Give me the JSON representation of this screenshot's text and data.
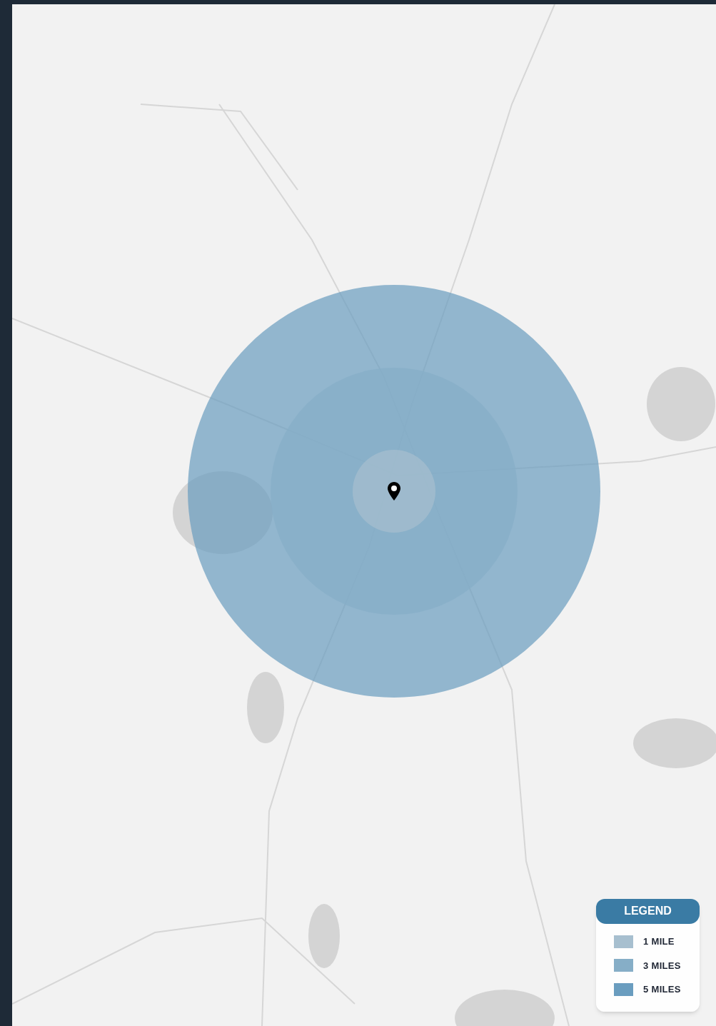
{
  "legend": {
    "title": "LEGEND",
    "items": [
      {
        "label": "1 MILE",
        "color": "#a7bfcf"
      },
      {
        "label": "3 MILES",
        "color": "#86aec7"
      },
      {
        "label": "5 MILES",
        "color": "#6a9dbf"
      }
    ]
  }
}
